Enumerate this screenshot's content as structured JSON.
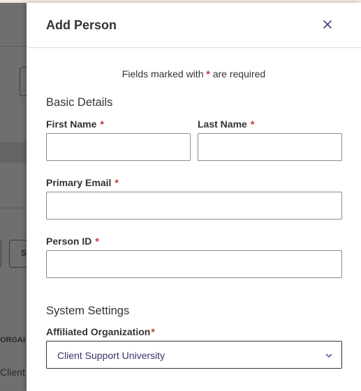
{
  "background": {
    "snippets": [
      "S",
      "ORGAI",
      "Client"
    ]
  },
  "drawer": {
    "title": "Add Person",
    "required_note_prefix": "Fields marked with",
    "required_marker": "*",
    "required_note_suffix": "are required",
    "sections": {
      "basic": "Basic Details",
      "system": "System Settings"
    },
    "fields": {
      "first_name": {
        "label": "First Name",
        "value": ""
      },
      "last_name": {
        "label": "Last Name",
        "value": ""
      },
      "primary_email": {
        "label": "Primary Email",
        "value": ""
      },
      "person_id": {
        "label": "Person ID",
        "value": ""
      },
      "affiliated_org": {
        "label": "Affiliated Organization",
        "value": "Client Support University"
      }
    },
    "icons": {
      "close": "close-icon",
      "chevron": "chevron-down-icon"
    }
  },
  "colors": {
    "required": "#c0392b",
    "select_text": "#3b3168"
  }
}
